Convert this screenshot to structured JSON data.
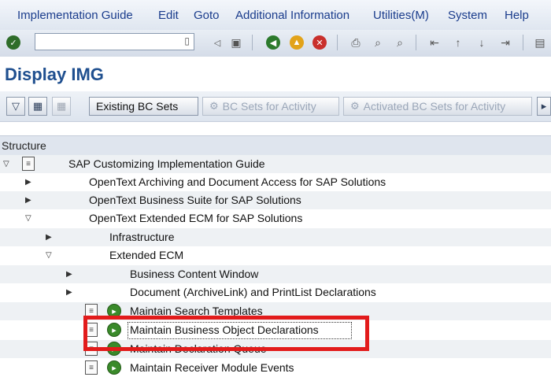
{
  "menu": {
    "items": [
      "Implementation Guide",
      "Edit",
      "Goto",
      "Additional Information",
      "Utilities(M)",
      "System",
      "Help"
    ]
  },
  "toolbar": {
    "command_field_value": "",
    "icons": [
      "check-icon",
      "back-icon",
      "save-icon",
      "back-arrow-icon",
      "exit-icon",
      "cancel-icon",
      "print-icon",
      "find-icon",
      "find-next-icon",
      "first-page-icon",
      "prev-page-icon",
      "next-page-icon",
      "last-page-icon",
      "new-session-icon"
    ]
  },
  "page": {
    "title": "Display IMG"
  },
  "app_toolbar": {
    "existing_bc_sets": "Existing BC Sets",
    "bc_sets_for_activity": "BC Sets for Activity",
    "activated_bc_sets_for_activity": "Activated BC Sets for Activity"
  },
  "tree": {
    "header": "Structure",
    "nodes": [
      {
        "label": "SAP Customizing Implementation Guide",
        "state": "expanded"
      },
      {
        "label": "OpenText Archiving and Document Access for SAP Solutions",
        "state": "collapsed"
      },
      {
        "label": "OpenText Business Suite for SAP Solutions",
        "state": "collapsed"
      },
      {
        "label": "OpenText Extended ECM for SAP Solutions",
        "state": "expanded"
      },
      {
        "label": "Infrastructure",
        "state": "collapsed"
      },
      {
        "label": "Extended ECM",
        "state": "expanded"
      },
      {
        "label": "Business Content Window",
        "state": "collapsed"
      },
      {
        "label": "Document (ArchiveLink) and PrintList Declarations",
        "state": "collapsed"
      },
      {
        "label": "Maintain Search Templates",
        "state": "activity"
      },
      {
        "label": "Maintain Business Object Declarations",
        "state": "activity",
        "selected": true
      },
      {
        "label": "Maintain Declaration Queue",
        "state": "activity"
      },
      {
        "label": "Maintain Receiver Module Events",
        "state": "activity"
      }
    ]
  },
  "colors": {
    "title": "#1f4f8f",
    "menu_text": "#1a3c8c",
    "highlight_box": "#e21b1b",
    "execute_icon": "#3a8a2a"
  }
}
